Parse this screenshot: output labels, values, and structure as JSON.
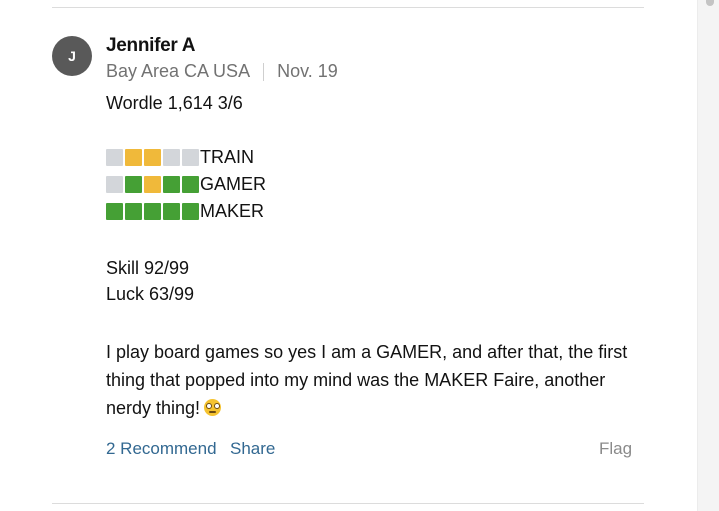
{
  "comment": {
    "avatar_initial": "J",
    "author": "Jennifer A",
    "location": "Bay Area CA USA",
    "date": "Nov. 19",
    "score_line": "Wordle 1,614 3/6",
    "grid": [
      {
        "word": "TRAIN",
        "tiles": [
          "gray",
          "yellow",
          "yellow",
          "gray",
          "gray"
        ]
      },
      {
        "word": "GAMER",
        "tiles": [
          "gray",
          "green",
          "yellow",
          "green",
          "green"
        ]
      },
      {
        "word": "MAKER",
        "tiles": [
          "green",
          "green",
          "green",
          "green",
          "green"
        ]
      }
    ],
    "skill": "Skill 92/99",
    "luck": "Luck 63/99",
    "paragraph_lines": [
      "I play board games so yes I am a GAMER, and after that, the first",
      "thing that popped into my mind was the MAKER Faire, another",
      "nerdy thing!"
    ],
    "emoji_icon": "nerd-face-icon"
  },
  "actions": {
    "recommend_label": "2 Recommend",
    "share_label": "Share",
    "flag_label": "Flag"
  },
  "colors": {
    "tile_gray": "#d3d6da",
    "tile_yellow": "#f0b93a",
    "tile_green": "#45a035",
    "link_blue": "#326891",
    "meta_gray": "#727272",
    "avatar_bg": "#595959"
  }
}
